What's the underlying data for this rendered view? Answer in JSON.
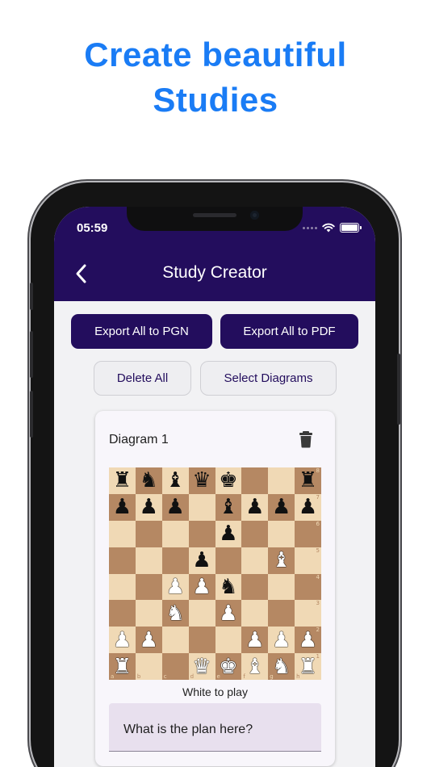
{
  "headline": {
    "line1": "Create beautiful",
    "line2": "Studies"
  },
  "status_bar": {
    "time": "05:59"
  },
  "app_bar": {
    "title": "Study Creator"
  },
  "actions": {
    "export_pgn": "Export All to PGN",
    "export_pdf": "Export All to PDF",
    "delete_all": "Delete All",
    "select_diagrams": "Select Diagrams"
  },
  "diagram": {
    "title": "Diagram 1",
    "to_play": "White to play",
    "question": "What is the plan here?",
    "files": [
      "a",
      "b",
      "c",
      "d",
      "e",
      "f",
      "g",
      "h"
    ],
    "ranks": [
      "8",
      "7",
      "6",
      "5",
      "4",
      "3",
      "2",
      "1"
    ],
    "board": [
      [
        "br",
        "bn",
        "bb",
        "bq",
        "bk",
        "",
        "",
        "br"
      ],
      [
        "bp",
        "bp",
        "bp",
        "",
        "bb",
        "bp",
        "bp",
        "bp"
      ],
      [
        "",
        "",
        "",
        "",
        "bp",
        "",
        "",
        ""
      ],
      [
        "",
        "",
        "",
        "bp",
        "",
        "",
        "wb",
        ""
      ],
      [
        "",
        "",
        "wp",
        "wp",
        "bn",
        "",
        "",
        ""
      ],
      [
        "",
        "",
        "wn",
        "",
        "wp",
        "",
        "",
        ""
      ],
      [
        "wp",
        "wp",
        "",
        "",
        "",
        "wp",
        "wp",
        "wp"
      ],
      [
        "wr",
        "",
        "",
        "wq",
        "wk",
        "wb",
        "wn",
        "wr"
      ]
    ]
  },
  "colors": {
    "accent": "#230d5d",
    "headline": "#1a7cf5",
    "light_square": "#f0d9b5",
    "dark_square": "#b58863"
  }
}
